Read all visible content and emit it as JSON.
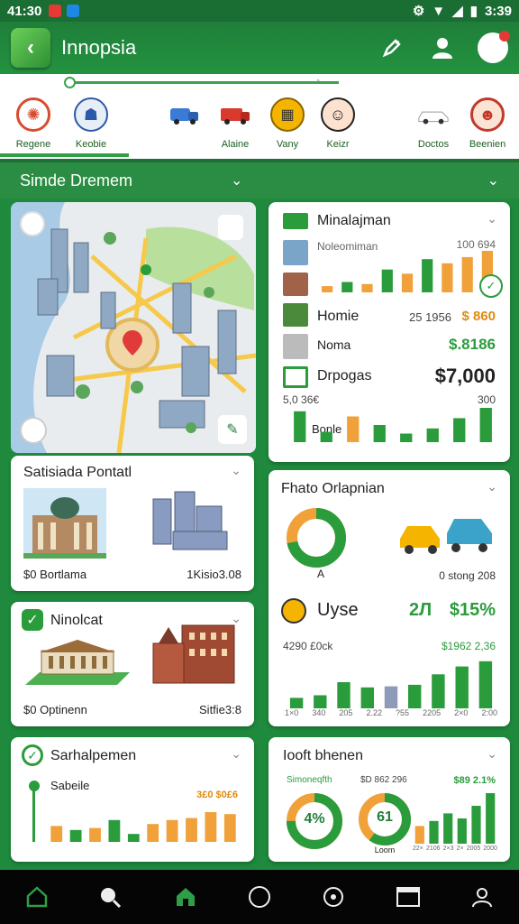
{
  "status": {
    "time": "41:30",
    "right_text": "3:39"
  },
  "app": {
    "title": "Innopsia"
  },
  "slider": {
    "label": "••°•"
  },
  "categories": [
    {
      "label": "Regene",
      "icon": "compass-icon",
      "color": "#d84b2e"
    },
    {
      "label": "Keobie",
      "icon": "police-icon",
      "color": "#2b5aa8"
    },
    {
      "label": "",
      "icon": "truck-icon",
      "color": "#3a7bd5"
    },
    {
      "label": "",
      "icon": "fire-truck-icon",
      "color": "#d83a2e"
    },
    {
      "label": "Alaine",
      "icon": "",
      "color": ""
    },
    {
      "label": "Vany",
      "icon": "calendar-icon",
      "color": "#f4b400"
    },
    {
      "label": "Keizr",
      "icon": "face-icon",
      "color": "#333"
    },
    {
      "label": "Doctos",
      "icon": "car-icon",
      "color": "#fff"
    },
    {
      "label": "Beenien",
      "icon": "doctor-icon",
      "color": "#c0392b"
    }
  ],
  "section": {
    "title": "Simde Dremem"
  },
  "card_management": {
    "title": "Minalajman",
    "sub1": "Noleomiman",
    "sub1_value": "100 694",
    "row2": {
      "label": "Homie",
      "value": "25 1956",
      "value2": "$ 860"
    },
    "row3": {
      "label": "Noma",
      "value": "$.8186"
    },
    "row4": {
      "label": "Drpogas",
      "value": "$7,000"
    },
    "row5": {
      "left": "5,0 36€",
      "right": "300"
    },
    "row6": {
      "label": "Bonle"
    },
    "bars_top": [
      {
        "v": 0.15,
        "c": "o"
      },
      {
        "v": 0.25,
        "c": "g"
      },
      {
        "v": 0.2,
        "c": "o"
      },
      {
        "v": 0.55,
        "c": "g"
      },
      {
        "v": 0.45,
        "c": "o"
      },
      {
        "v": 0.8,
        "c": "g"
      },
      {
        "v": 0.7,
        "c": "o"
      },
      {
        "v": 0.85,
        "c": "o"
      },
      {
        "v": 1.0,
        "c": "o"
      }
    ],
    "bars_bottom": [
      {
        "v": 0.9,
        "c": "g"
      },
      {
        "v": 0.3,
        "c": "g"
      },
      {
        "v": 0.75,
        "c": "o"
      },
      {
        "v": 0.5,
        "c": "g"
      },
      {
        "v": 0.25,
        "c": "g"
      },
      {
        "v": 0.4,
        "c": "g"
      },
      {
        "v": 0.7,
        "c": "g"
      },
      {
        "v": 1.0,
        "c": "g"
      }
    ]
  },
  "card_portal": {
    "title": "Satisiada Pontatl",
    "left": "$0 Bortlama",
    "right": "1Kisio3.08"
  },
  "card_photo": {
    "title": "Fhato Orlapnian",
    "donut_pct": 0.72,
    "donut_label": "A",
    "right_label": "0 stong 208",
    "row": {
      "label": "Uyse",
      "v1": "2Л",
      "v2": "$15%"
    },
    "labels_row": {
      "left": "4290 £0ck",
      "right": "$1962 2,36"
    },
    "bars": [
      {
        "v": 0.2,
        "c": "g"
      },
      {
        "v": 0.25,
        "c": "g"
      },
      {
        "v": 0.5,
        "c": "g"
      },
      {
        "v": 0.4,
        "c": "g"
      },
      {
        "v": 0.42,
        "c": "b"
      },
      {
        "v": 0.45,
        "c": "g"
      },
      {
        "v": 0.65,
        "c": "g"
      },
      {
        "v": 0.8,
        "c": "g"
      },
      {
        "v": 0.9,
        "c": "g"
      }
    ],
    "xlabels": [
      "1×0",
      "340",
      "205",
      "2.22",
      "?55",
      "2205",
      "2×0",
      "2:00"
    ]
  },
  "card_ninolecat": {
    "title": "Ninolcat",
    "left": "$0 Optinenn",
    "right": "Sitfie3:8"
  },
  "card_sarhal": {
    "title": "Sarhalpemen",
    "sub": "Sabeile",
    "value": "3£0 $0£6",
    "bars": [
      {
        "v": 0.4,
        "c": "o"
      },
      {
        "v": 0.3,
        "c": "g"
      },
      {
        "v": 0.35,
        "c": "o"
      },
      {
        "v": 0.55,
        "c": "g"
      },
      {
        "v": 0.2,
        "c": "g"
      },
      {
        "v": 0.45,
        "c": "o"
      },
      {
        "v": 0.55,
        "c": "o"
      },
      {
        "v": 0.6,
        "c": "o"
      },
      {
        "v": 0.75,
        "c": "o"
      },
      {
        "v": 0.7,
        "c": "o"
      }
    ]
  },
  "card_loot": {
    "title": "Iooft bhenen",
    "label_left": "Simoneqfth",
    "label_mid": "$D 862 296",
    "label_right": "$89 2.1%",
    "donut1": {
      "pct": 0.75,
      "text": "4%"
    },
    "donut2": {
      "pct": 0.6,
      "text": "61"
    },
    "donut2_sub": "Loom",
    "bars": [
      {
        "v": 0.35,
        "c": "o"
      },
      {
        "v": 0.45,
        "c": "g"
      },
      {
        "v": 0.6,
        "c": "g"
      },
      {
        "v": 0.5,
        "c": "g"
      },
      {
        "v": 0.75,
        "c": "g"
      },
      {
        "v": 1.0,
        "c": "g"
      }
    ],
    "xlabels": [
      "22×",
      "2106",
      "2×3",
      "2×",
      "2005",
      "2000"
    ]
  },
  "colors": {
    "green": "#2a9c3c",
    "orange": "#f0a13a",
    "dark_green": "#1f7e3a"
  }
}
